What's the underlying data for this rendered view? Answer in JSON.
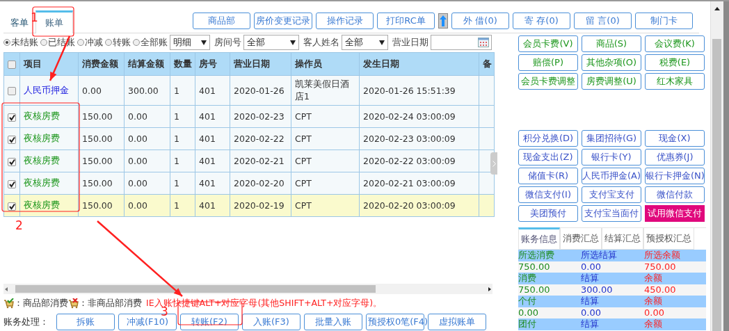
{
  "tabs": [
    {
      "label": "客单",
      "selected": false
    },
    {
      "label": "账单",
      "selected": true
    }
  ],
  "toolbar": [
    {
      "kind": "button",
      "label": "商品部"
    },
    {
      "kind": "button",
      "label": "房价变更记录"
    },
    {
      "kind": "button",
      "label": "操作记录"
    },
    {
      "kind": "button",
      "label": "打印RC单"
    },
    {
      "kind": "icon"
    },
    {
      "kind": "button",
      "label": "外 借(0)"
    },
    {
      "kind": "button",
      "label": "寄 存(0)"
    },
    {
      "kind": "button",
      "label": "留 言(0)"
    },
    {
      "kind": "button",
      "label": "制门卡"
    }
  ],
  "filters": {
    "status_options": [
      {
        "label": "未结账",
        "selected": true
      },
      {
        "label": "已结账",
        "selected": false
      },
      {
        "label": "冲减",
        "selected": false
      },
      {
        "label": "转账",
        "selected": false
      },
      {
        "label": "全部账",
        "selected": false
      }
    ],
    "view_select": "明细",
    "room_label": "房间号",
    "room_select": "全部",
    "guest_label": "客人姓名",
    "guest_select": "全部",
    "date_label": "营业日期"
  },
  "table": {
    "header_checked": false,
    "columns": [
      "项目",
      "消费金额",
      "结算金额",
      "数量",
      "房号",
      "营业日期",
      "操作员",
      "发生日期",
      "备"
    ],
    "rows": [
      {
        "checked": false,
        "selected": false,
        "kind": "deposit",
        "cells": [
          "人民币押金",
          "0.00",
          "300.00",
          "1",
          "401",
          "2020-01-26",
          "凯莱美假日酒店1",
          "2020-01-26 15:51:39"
        ]
      },
      {
        "checked": true,
        "selected": false,
        "kind": "charge",
        "cells": [
          "夜核房费",
          "150.00",
          "0.00",
          "1",
          "401",
          "2020-02-23",
          "CPT",
          "2020-02-24 03:00:09"
        ]
      },
      {
        "checked": true,
        "selected": false,
        "kind": "charge",
        "cells": [
          "夜核房费",
          "150.00",
          "0.00",
          "1",
          "401",
          "2020-02-22",
          "CPT",
          "2020-02-23 03:00:09"
        ]
      },
      {
        "checked": true,
        "selected": false,
        "kind": "charge",
        "cells": [
          "夜核房费",
          "150.00",
          "0.00",
          "1",
          "401",
          "2020-02-21",
          "CPT",
          "2020-02-22 03:00:09"
        ]
      },
      {
        "checked": true,
        "selected": false,
        "kind": "charge",
        "cells": [
          "夜核房费",
          "150.00",
          "0.00",
          "1",
          "401",
          "2020-02-20",
          "CPT",
          "2020-02-21 03:00:09"
        ]
      },
      {
        "checked": true,
        "selected": true,
        "kind": "charge",
        "cells": [
          "夜核房费",
          "150.00",
          "0.00",
          "1",
          "401",
          "2020-02-19",
          "CPT",
          "2020-02-20 03:00:09"
        ]
      }
    ]
  },
  "legend": {
    "items": [
      "：商品部消费",
      "：非商品部消费"
    ],
    "hint": "IE入账快捷键ALT+对应字母(其他SHIFT+ALT+对应字母)。"
  },
  "actions": {
    "label": "账务处理：",
    "buttons": [
      "拆账",
      "冲减(F10)",
      "转账(F2)",
      "入账(F3)",
      "批量入账",
      "预授权0笔(F4)",
      "虚拟账单"
    ]
  },
  "charge_buttons": [
    "会员卡费(V)",
    "商品(S)",
    "会议费(K)",
    "赔偿(P)",
    "其他杂项(O)",
    "税费(E)",
    "会员卡费调整",
    "房费调整(U)",
    "红木家具"
  ],
  "payment_buttons": [
    {
      "label": "积分兑换(D)",
      "kind": "normal"
    },
    {
      "label": "集团招待(G)",
      "kind": "normal"
    },
    {
      "label": "现金(X)",
      "kind": "normal"
    },
    {
      "label": "现金支出(Z)",
      "kind": "normal"
    },
    {
      "label": "银行卡(Y)",
      "kind": "normal"
    },
    {
      "label": "优惠券(J)",
      "kind": "normal"
    },
    {
      "label": "储值卡(R)",
      "kind": "normal"
    },
    {
      "label": "人民币押金(A)",
      "kind": "normal"
    },
    {
      "label": "银行卡押金(N)",
      "kind": "normal"
    },
    {
      "label": "微信支付(I)",
      "kind": "normal"
    },
    {
      "label": "支付宝支付",
      "kind": "normal"
    },
    {
      "label": "微信付款",
      "kind": "normal"
    },
    {
      "label": "美团预付",
      "kind": "normal"
    },
    {
      "label": "支付宝当面付",
      "kind": "normal"
    },
    {
      "label": "试用微信支付",
      "kind": "accent"
    }
  ],
  "info_tabs": [
    {
      "label": "账务信息",
      "selected": true
    },
    {
      "label": "消费汇总",
      "selected": false
    },
    {
      "label": "结算汇总",
      "selected": false
    },
    {
      "label": "预授权汇总",
      "selected": false
    }
  ],
  "info_rows": [
    {
      "kind": "header",
      "cells": [
        "所选消费",
        "所选结算",
        "所选余额"
      ]
    },
    {
      "kind": "value",
      "cells": [
        "750.00",
        "0.00",
        "750.00"
      ]
    },
    {
      "kind": "header",
      "cells": [
        "消费",
        "结算",
        "余额"
      ]
    },
    {
      "kind": "value",
      "cells": [
        "750.00",
        "300.00",
        "450.00"
      ]
    },
    {
      "kind": "header",
      "cells": [
        "个付",
        "结算",
        "余额"
      ]
    },
    {
      "kind": "value",
      "cells": [
        "0.00",
        "0.00",
        "0.00"
      ]
    },
    {
      "kind": "header",
      "cells": [
        "团付",
        "结算",
        "余额"
      ]
    }
  ],
  "annotations": [
    {
      "number": "1"
    },
    {
      "number": "2"
    },
    {
      "number": "3"
    }
  ]
}
